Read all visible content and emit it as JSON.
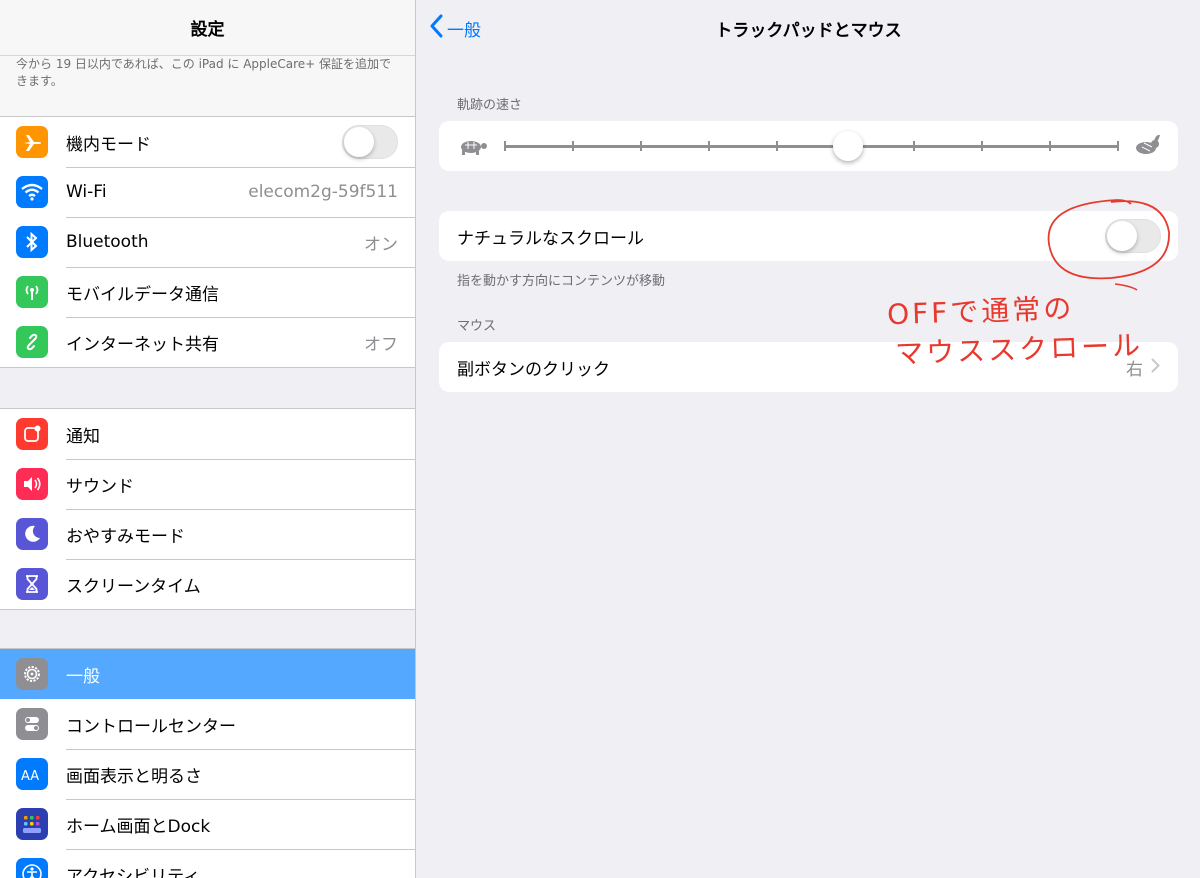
{
  "sidebar": {
    "title": "設定",
    "notice": "今から 19 日以内であれば、この iPad に AppleCare+ 保証を追加できます。",
    "groups": [
      {
        "items": [
          {
            "label": "機内モード",
            "icon": "airplane-icon",
            "color": "#ff9500",
            "control": "toggle",
            "value": ""
          },
          {
            "label": "Wi-Fi",
            "icon": "wifi-icon",
            "color": "#007aff",
            "value": "elecom2g-59f511"
          },
          {
            "label": "Bluetooth",
            "icon": "bluetooth-icon",
            "color": "#007aff",
            "value": "オン"
          },
          {
            "label": "モバイルデータ通信",
            "icon": "antenna-icon",
            "color": "#34c759",
            "value": ""
          },
          {
            "label": "インターネット共有",
            "icon": "link-icon",
            "color": "#34c759",
            "value": "オフ"
          }
        ]
      },
      {
        "items": [
          {
            "label": "通知",
            "icon": "notification-icon",
            "color": "#ff3b30",
            "value": ""
          },
          {
            "label": "サウンド",
            "icon": "speaker-icon",
            "color": "#ff2d55",
            "value": ""
          },
          {
            "label": "おやすみモード",
            "icon": "moon-icon",
            "color": "#5856d6",
            "value": ""
          },
          {
            "label": "スクリーンタイム",
            "icon": "hourglass-icon",
            "color": "#5856d6",
            "value": ""
          }
        ]
      },
      {
        "items": [
          {
            "label": "一般",
            "icon": "gear-icon",
            "color": "#8e8e93",
            "value": "",
            "selected": true
          },
          {
            "label": "コントロールセンター",
            "icon": "switches-icon",
            "color": "#8e8e93",
            "value": ""
          },
          {
            "label": "画面表示と明るさ",
            "icon": "text-size-icon",
            "color": "#007aff",
            "value": ""
          },
          {
            "label": "ホーム画面とDock",
            "icon": "home-grid-icon",
            "color": "#2c3fb0",
            "value": ""
          },
          {
            "label": "アクセシビリティ",
            "icon": "accessibility-icon",
            "color": "#007aff",
            "value": ""
          }
        ]
      }
    ],
    "airplane_mode_on": false
  },
  "main": {
    "back_label": "一般",
    "title": "トラックパッドとマウス",
    "tracking_label": "軌跡の速さ",
    "tracking_speed": 0.56,
    "tracking_ticks": 10,
    "natural_scroll_label": "ナチュラルなスクロール",
    "natural_scroll_on": false,
    "natural_scroll_footer": "指を動かす方向にコンテンツが移動",
    "mouse_section": "マウス",
    "secondary_click_label": "副ボタンのクリック",
    "secondary_click_value": "右"
  },
  "annotation": {
    "line1": "OFFで通常の",
    "line2": "マウススクロール",
    "color": "#e8392f"
  },
  "colors": {
    "accent": "#007aff",
    "selected_row": "#54a8ff"
  }
}
